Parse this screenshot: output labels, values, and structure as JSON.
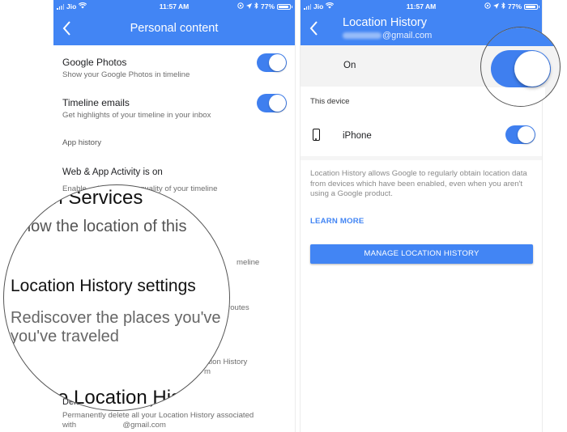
{
  "status_bar": {
    "carrier": "Jio",
    "time": "11:57 AM",
    "battery": "77%"
  },
  "left_screen": {
    "title": "Personal content",
    "items": [
      {
        "title": "Google Photos",
        "subtitle": "Show your Google Photos in timeline",
        "toggle_on": true
      },
      {
        "title": "Timeline emails",
        "subtitle": "Get highlights of your timeline in your inbox",
        "toggle_on": true
      }
    ],
    "section_app_history": "App history",
    "web_app_activity": {
      "title": "Web & App Activity is on",
      "subtitle": "Enable ... improve the quality of your timeline"
    },
    "partial_texts": {
      "timeline_fragment": "meline",
      "routes_fragment": "routes",
      "location_history_fragment": "ation History",
      "m_fragment": "m"
    },
    "delete_item": {
      "title": "Delete Location History",
      "subtitle_line1": "Permanently delete all your Location History associated",
      "subtitle_line2_prefix": "with",
      "subtitle_line2_suffix": "@gmail.com"
    }
  },
  "left_magnifier": {
    "line1": "on Services",
    "line2": "how the location of this",
    "heading": "Location History settings",
    "desc_line1": "Rediscover the places you've",
    "desc_line2": "you've traveled",
    "bottom_text": "e Location His"
  },
  "right_screen": {
    "title": "Location History",
    "account_suffix": "@gmail.com",
    "master_label": "On",
    "master_toggle_on": true,
    "section_label": "This device",
    "device": {
      "name": "iPhone",
      "toggle_on": true
    },
    "info_text": "Location History allows Google to regularly obtain location data from devices which have been enabled, even when you aren't using a Google product.",
    "learn_more": "LEARN MORE",
    "manage_button": "MANAGE LOCATION HISTORY"
  },
  "colors": {
    "accent": "#4285f4",
    "toggle": "#3f7fef"
  }
}
